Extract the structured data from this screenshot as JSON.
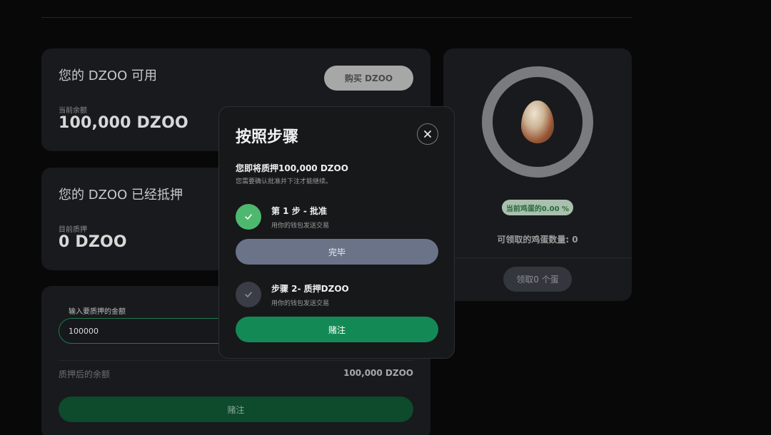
{
  "available": {
    "title": "您的 DZOO 可用",
    "buy_label": "购买 DZOO",
    "balance_label": "当前余额",
    "balance_value": "100,000 DZOO"
  },
  "staked": {
    "title": "您的 DZOO 已经抵押",
    "staked_label": "目前质押",
    "staked_value": "0 DZOO"
  },
  "stake_form": {
    "input_label": "输入要质押的金额",
    "input_value": "100000",
    "after_label": "质押后的余额",
    "after_value": "100,000 DZOO",
    "stake_label": "赌注"
  },
  "egg": {
    "badge": "当前鸡蛋的0.00 %",
    "claimable": "可领取的鸡蛋数量:  0",
    "claim_label": "领取0 个蛋"
  },
  "modal": {
    "title": "按照步骤",
    "heading": "您即将质押100,000 DZOO",
    "subheading": "您需要确认批准并下注才能继续。",
    "step1_title": "第 1 步 - 批准",
    "step1_sub": "用你的钱包发送交易",
    "done_label": "完毕",
    "step2_title": "步骤 2- 质押DZOO",
    "step2_sub": "用你的钱包发送交易",
    "bet_label": "赌注"
  },
  "colors": {
    "accent_green": "#138a55",
    "check_green": "#4fb86f",
    "done_button": "#6b7389"
  },
  "icons": {
    "close": "close-icon",
    "step1": "check-icon",
    "step2": "check-icon"
  }
}
